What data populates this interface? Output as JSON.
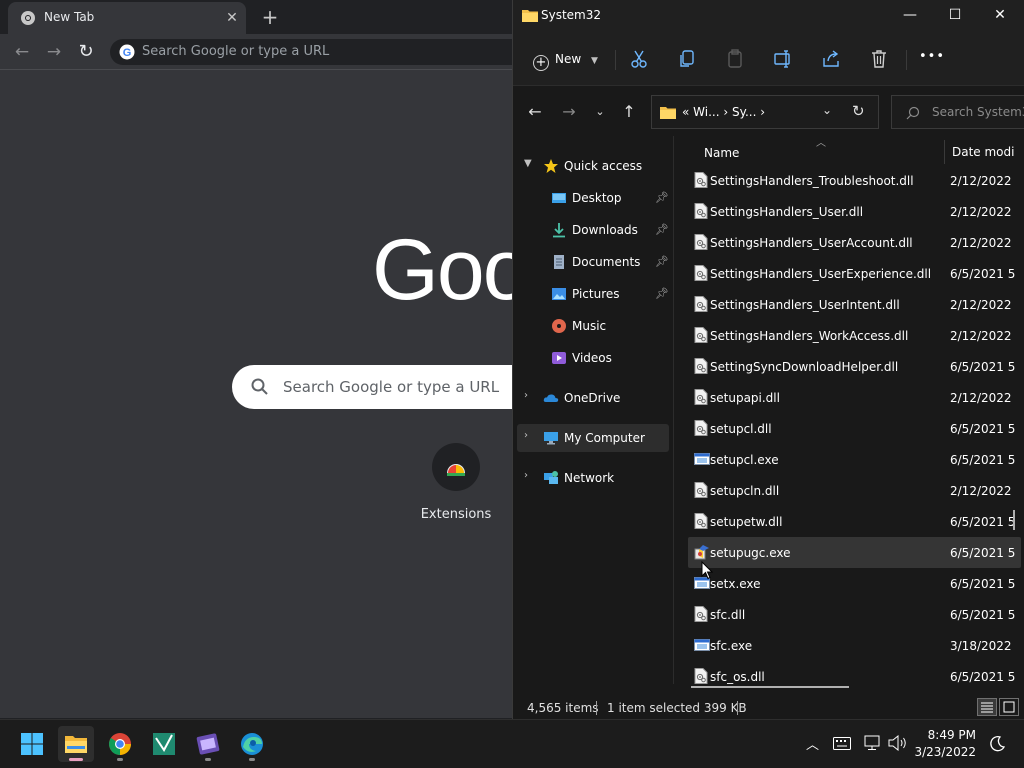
{
  "chrome": {
    "tab_title": "New Tab",
    "tab_close": "✕",
    "new_tab": "+",
    "omnibox_placeholder": "Search Google or type a URL",
    "logo_text": "Goo",
    "search_placeholder": "Search Google or type a URL",
    "shortcut_label": "Extensions"
  },
  "explorer": {
    "window_title": "System32",
    "controls": {
      "minimize": "—",
      "maximize": "☐",
      "close": "✕"
    },
    "new_label": "New",
    "more_label": "•••",
    "breadcrumbs": "«  Wi...  ›  Sy...  ›",
    "search_placeholder": "Search System32",
    "nav": {
      "quick_access": "Quick access",
      "desktop": "Desktop",
      "downloads": "Downloads",
      "documents": "Documents",
      "pictures": "Pictures",
      "music": "Music",
      "videos": "Videos",
      "onedrive": "OneDrive",
      "my_computer": "My Computer",
      "network": "Network"
    },
    "columns": {
      "name": "Name",
      "date": "Date modi"
    },
    "files": [
      {
        "name": "SettingsHandlers_Troubleshoot.dll",
        "date": "2/12/2022",
        "type": "dll"
      },
      {
        "name": "SettingsHandlers_User.dll",
        "date": "2/12/2022",
        "type": "dll"
      },
      {
        "name": "SettingsHandlers_UserAccount.dll",
        "date": "2/12/2022",
        "type": "dll"
      },
      {
        "name": "SettingsHandlers_UserExperience.dll",
        "date": "6/5/2021 5",
        "type": "dll"
      },
      {
        "name": "SettingsHandlers_UserIntent.dll",
        "date": "2/12/2022",
        "type": "dll"
      },
      {
        "name": "SettingsHandlers_WorkAccess.dll",
        "date": "2/12/2022",
        "type": "dll"
      },
      {
        "name": "SettingSyncDownloadHelper.dll",
        "date": "6/5/2021 5",
        "type": "dll"
      },
      {
        "name": "setupapi.dll",
        "date": "2/12/2022",
        "type": "dll"
      },
      {
        "name": "setupcl.dll",
        "date": "6/5/2021 5",
        "type": "dll"
      },
      {
        "name": "setupcl.exe",
        "date": "6/5/2021 5",
        "type": "exe"
      },
      {
        "name": "setupcln.dll",
        "date": "2/12/2022",
        "type": "dll"
      },
      {
        "name": "setupetw.dll",
        "date": "6/5/2021 5",
        "type": "dll"
      },
      {
        "name": "setupugc.exe",
        "date": "6/5/2021 5",
        "type": "exe-special"
      },
      {
        "name": "setx.exe",
        "date": "6/5/2021 5",
        "type": "exe"
      },
      {
        "name": "sfc.dll",
        "date": "6/5/2021 5",
        "type": "dll"
      },
      {
        "name": "sfc.exe",
        "date": "3/18/2022",
        "type": "exe"
      },
      {
        "name": "sfc_os.dll",
        "date": "6/5/2021 5",
        "type": "dll"
      }
    ],
    "selected_index": 12,
    "status": {
      "items": "4,565 items",
      "selected": "1 item selected  399 KB"
    }
  },
  "taskbar": {
    "apps": [
      "start-icon",
      "file-explorer-icon",
      "chrome-icon",
      "visual-studio-icon",
      "video-editor-icon",
      "edge-icon"
    ],
    "time": "8:49 PM",
    "date": "3/23/2022"
  }
}
